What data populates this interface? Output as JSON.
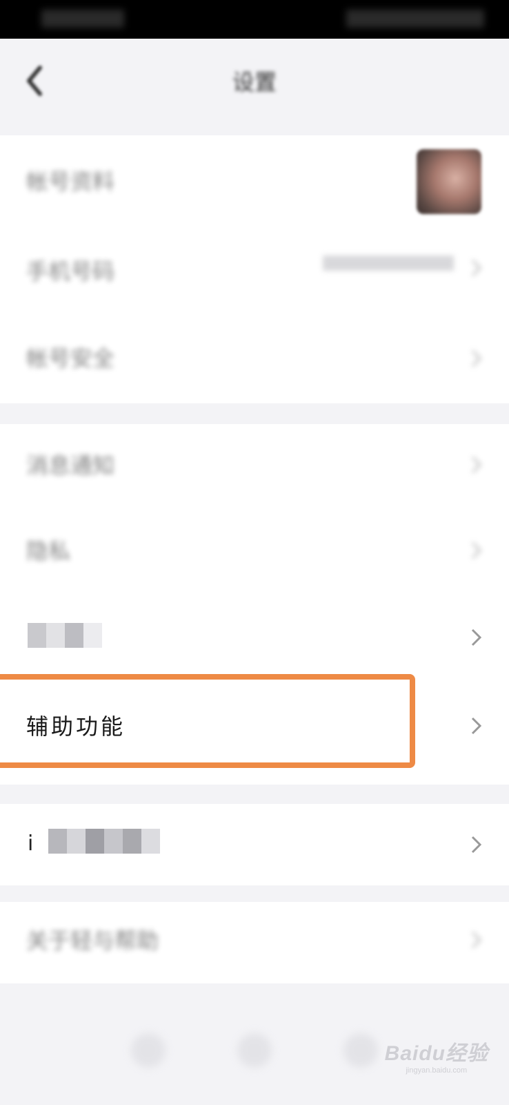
{
  "header": {
    "title": "设置"
  },
  "account_group": {
    "rows": [
      {
        "label": "帐号资料"
      },
      {
        "label": "手机号码"
      },
      {
        "label": "帐号安全"
      }
    ]
  },
  "settings_group": {
    "rows": [
      {
        "label": "消息通知"
      },
      {
        "label": "隐私"
      },
      {
        "label": ""
      },
      {
        "label": "辅助功能"
      }
    ]
  },
  "third_group": {
    "rows": [
      {
        "label": "ⅰ"
      }
    ]
  },
  "about_group": {
    "rows": [
      {
        "label": "关于轻与帮助"
      }
    ]
  },
  "highlight": {
    "color": "#ee8a45"
  },
  "watermark": {
    "logo": "Baidu经验",
    "url": "jingyan.baidu.com"
  },
  "icons": {
    "back": "back-arrow-icon",
    "chevron": "chevron-right-icon"
  }
}
